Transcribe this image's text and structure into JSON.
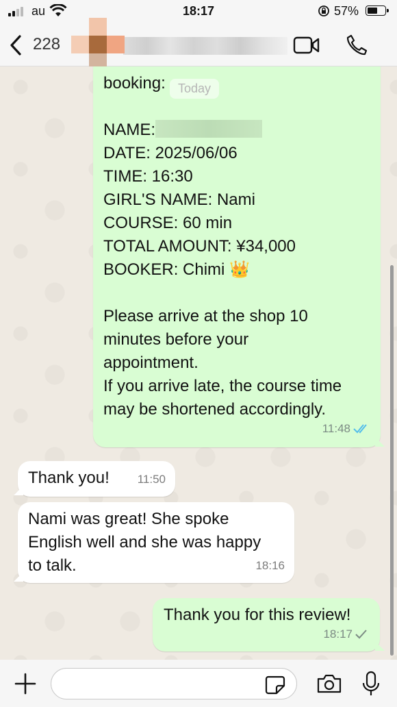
{
  "status_bar": {
    "carrier": "au",
    "time": "18:17",
    "battery": "57%"
  },
  "header": {
    "contact_partial": "228"
  },
  "chat": {
    "date_chip": "Today",
    "booking_message": {
      "partial_line": "booking:",
      "name_label": "NAME:",
      "lines": [
        "DATE: 2025/06/06",
        "TIME: 16:30",
        "GIRL'S NAME: Nami",
        "COURSE: 60 min",
        "TOTAL AMOUNT: ¥34,000",
        "BOOKER: Chimi 👑"
      ],
      "notice": [
        "Please arrive at the shop 10",
        "minutes before your",
        "appointment.",
        "If you arrive late, the course time",
        "may be shortened accordingly."
      ],
      "time": "11:48"
    },
    "incoming_1": {
      "text": "Thank you!",
      "time": "11:50"
    },
    "incoming_2": {
      "lines": [
        "Nami was great! She spoke",
        "English well and she was happy",
        "to talk."
      ],
      "time": "18:16"
    },
    "outgoing_1": {
      "text": "Thank you for this review!",
      "time": "18:17"
    }
  },
  "icons": [
    "back-chevron-icon",
    "video-call-icon",
    "phone-icon",
    "plus-icon",
    "sticker-icon",
    "camera-icon",
    "mic-icon",
    "double-check-icon",
    "single-check-icon"
  ],
  "colors": {
    "outgoing_bubble": "#d9fdd3",
    "incoming_bubble": "#ffffff",
    "read_check": "#53bdeb",
    "chat_bg": "#efeae2"
  }
}
